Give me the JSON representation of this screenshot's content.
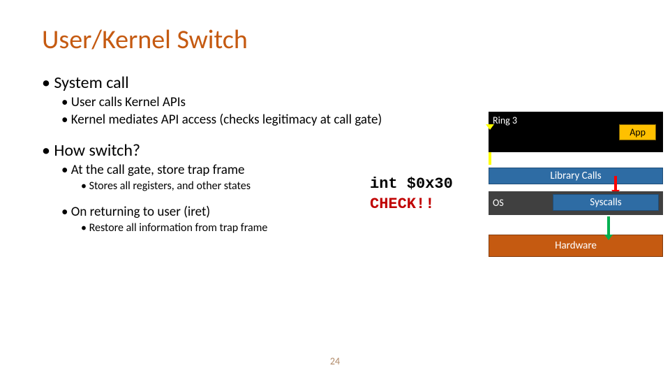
{
  "title": "User/Kernel Switch",
  "bullets": {
    "b1": "System call",
    "b1a": "User calls Kernel APIs",
    "b1b": "Kernel mediates API access (checks legitimacy at call gate)",
    "b2": "How switch?",
    "b2a": "At the call gate, store trap frame",
    "b2a1": "Stores all registers, and other states",
    "b2b": "On returning to user (iret)",
    "b2b1": "Restore all information from trap frame"
  },
  "code": {
    "line1": "int $0x30",
    "line2": "CHECK!!"
  },
  "diagram": {
    "ring_label": "Ring 3",
    "app": "App",
    "library": "Library Calls",
    "os_label": "OS",
    "syscalls": "Syscalls",
    "hardware": "Hardware"
  },
  "page_number": "24"
}
